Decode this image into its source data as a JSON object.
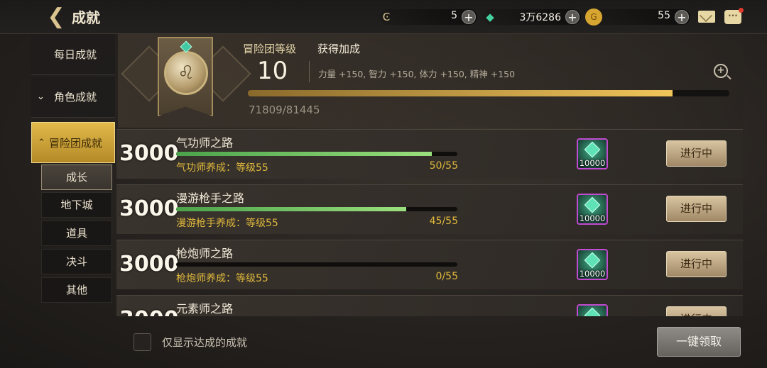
{
  "header": {
    "back_icon": "back-arrow-icon",
    "title": "成就",
    "resources": [
      {
        "icon": "swirl-token-icon",
        "value": "5"
      },
      {
        "icon": "green-gem-icon",
        "value": "3万6286"
      },
      {
        "icon": "gold-coin-icon",
        "value": "55"
      }
    ],
    "mail_icon": "mail-icon",
    "chat_icon": "chat-icon"
  },
  "sidebar": {
    "main": [
      {
        "label": "每日成就",
        "active": false
      },
      {
        "label": "角色成就",
        "active": false,
        "chevron": "⌄"
      },
      {
        "label": "冒险团成就",
        "active": true,
        "chevron": "⌃"
      }
    ],
    "sub": [
      {
        "label": "成长",
        "active": true
      },
      {
        "label": "地下城",
        "active": false
      },
      {
        "label": "道具",
        "active": false
      },
      {
        "label": "决斗",
        "active": false
      },
      {
        "label": "其他",
        "active": false
      }
    ]
  },
  "level_panel": {
    "level_label": "冒险团等级",
    "level": "10",
    "bonus_title": "获得加成",
    "bonus_text": "力量 +150, 智力 +150, 体力 +150, 精神 +150",
    "xp_text": "71809/81445",
    "xp_fraction": 0.8817
  },
  "achievements": [
    {
      "points": "3000",
      "name": "气功师之路",
      "desc": "气功师养成：等级55",
      "progress": "50/55",
      "fraction": 0.909,
      "reward_qty": "10000",
      "button": "进行中"
    },
    {
      "points": "3000",
      "name": "漫游枪手之路",
      "desc": "漫游枪手养成：等级55",
      "progress": "45/55",
      "fraction": 0.818,
      "reward_qty": "10000",
      "button": "进行中"
    },
    {
      "points": "3000",
      "name": "枪炮师之路",
      "desc": "枪炮师养成：等级55",
      "progress": "0/55",
      "fraction": 0.0,
      "reward_qty": "10000",
      "button": "进行中"
    },
    {
      "points": "3000",
      "name": "元素师之路",
      "desc": "",
      "progress": "",
      "fraction": 0.0,
      "reward_qty": "10000",
      "button": "进行中"
    }
  ],
  "footer": {
    "checkbox_label": "仅显示达成的成就",
    "claim_all": "一键领取"
  }
}
